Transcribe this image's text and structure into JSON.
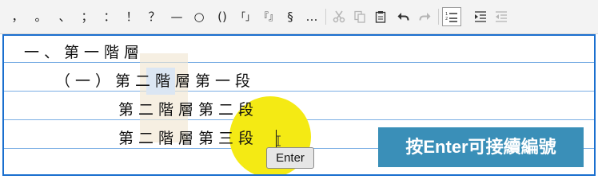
{
  "toolbar": {
    "punctuation": [
      {
        "name": "comma-button",
        "label": "，"
      },
      {
        "name": "period-button",
        "label": "。"
      },
      {
        "name": "enumeration-comma-button",
        "label": "、"
      },
      {
        "name": "semicolon-button",
        "label": "；"
      },
      {
        "name": "colon-button",
        "label": "："
      },
      {
        "name": "exclamation-button",
        "label": "！"
      },
      {
        "name": "question-button",
        "label": "？"
      },
      {
        "name": "dash-button",
        "label": "—"
      },
      {
        "name": "circle-button",
        "label": "○"
      },
      {
        "name": "parentheses-button",
        "label": "()"
      },
      {
        "name": "corner-quote-button",
        "label": "「」"
      },
      {
        "name": "double-corner-quote-button",
        "label": "『』"
      },
      {
        "name": "section-sign-button",
        "label": "§"
      },
      {
        "name": "ellipsis-button",
        "label": "…"
      }
    ],
    "icons": [
      "cut-icon",
      "copy-icon",
      "paste-icon",
      "undo-icon",
      "redo-icon",
      "numbered-list-icon",
      "increase-indent-icon",
      "decrease-indent-icon"
    ],
    "accent_color": "#1a6fcf"
  },
  "editor": {
    "lines": [
      "一、第一階層",
      "（一）第二階層第一段",
      "第二階層第二段",
      "第二階層第三段"
    ],
    "rule_color": "#7aaee4"
  },
  "overlay": {
    "enter_key_label": "Enter",
    "callout_text": "按Enter可接續編號",
    "callout_color": "#3a8fb8",
    "highlight_color": "#f4ea14"
  }
}
